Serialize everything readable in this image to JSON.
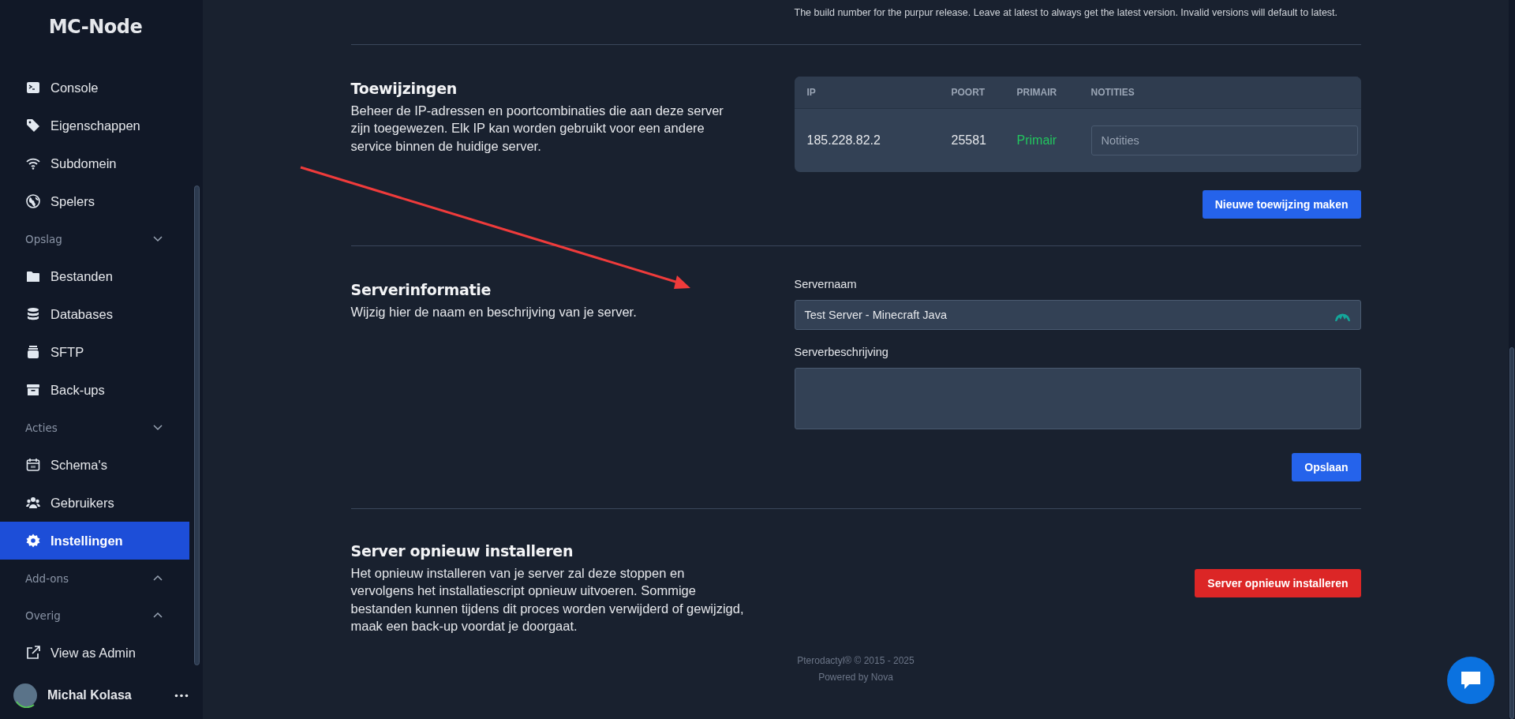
{
  "sidebar": {
    "logo": "MC-Node",
    "groups": [
      {
        "items": [
          {
            "label": "Console",
            "selected": false
          },
          {
            "label": "Eigenschappen",
            "selected": false
          },
          {
            "label": "Subdomein",
            "selected": false
          },
          {
            "label": "Spelers",
            "selected": false
          }
        ]
      },
      {
        "label": "Opslag",
        "expanded": true,
        "items": [
          {
            "label": "Bestanden",
            "selected": false
          },
          {
            "label": "Databases",
            "selected": false
          },
          {
            "label": "SFTP",
            "selected": false
          },
          {
            "label": "Back-ups",
            "selected": false
          }
        ]
      },
      {
        "label": "Acties",
        "expanded": true,
        "items": [
          {
            "label": "Schema's",
            "selected": false
          },
          {
            "label": "Gebruikers",
            "selected": false
          },
          {
            "label": "Instellingen",
            "selected": true
          }
        ]
      },
      {
        "label": "Add-ons",
        "expanded": false
      },
      {
        "label": "Overig",
        "expanded": false,
        "items": [
          {
            "label": "View as Admin",
            "selected": false
          }
        ]
      }
    ],
    "user": {
      "name": "Michal Kolasa"
    }
  },
  "build_help": "The build number for the purpur release. Leave at latest to always get the latest version. Invalid versions will default to latest.",
  "allocations": {
    "title": "Toewijzingen",
    "description": "Beheer de IP-adressen en poortcombinaties die aan deze server zijn toegewezen. Elk IP kan worden gebruikt voor een andere service binnen de huidige server.",
    "columns": [
      "IP",
      "POORT",
      "PRIMAIR",
      "NOTITIES"
    ],
    "rows": [
      {
        "ip": "185.228.82.2",
        "port": "25581",
        "primary": true,
        "primary_label": "Primair",
        "notes_placeholder": "Notities"
      }
    ],
    "button": "Nieuwe toewijzing maken"
  },
  "server_info": {
    "title": "Serverinformatie",
    "description": "Wijzig hier de naam en beschrijving van je server.",
    "fields": [
      {
        "kind": "input",
        "label": "Servernaam",
        "value": "Test Server - Minecraft Java"
      },
      {
        "kind": "textarea",
        "label": "Serverbeschrijving"
      }
    ],
    "button": "Opslaan"
  },
  "reinstall": {
    "title": "Server opnieuw installeren",
    "description": "Het opnieuw installeren van je server zal deze stoppen en vervolgens het installatiescript opnieuw uitvoeren. Sommige bestanden kunnen tijdens dit proces worden verwijderd of gewijzigd, maak een back-up voordat je doorgaat.",
    "button": "Server opnieuw installeren"
  },
  "footer": [
    "Pterodactyl® © 2015 - 2025",
    "Powered by Nova"
  ]
}
